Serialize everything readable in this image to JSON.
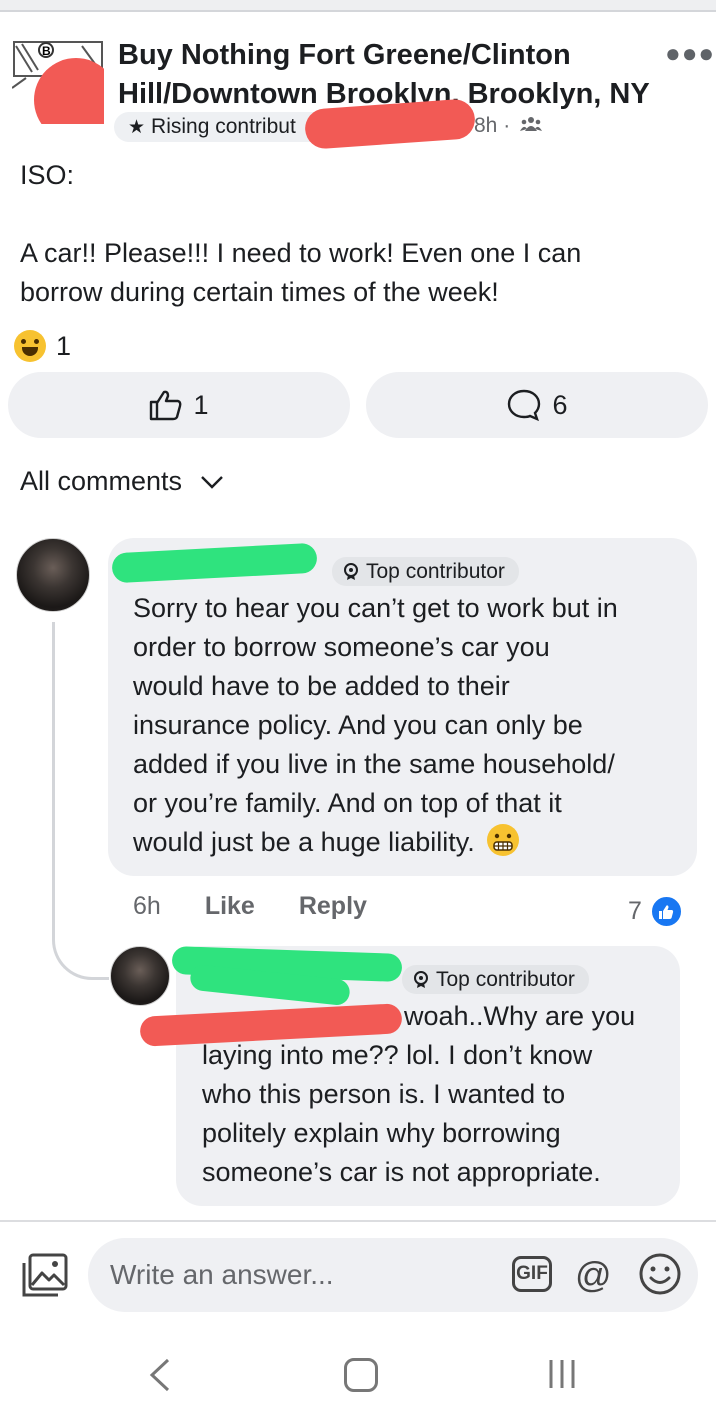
{
  "post": {
    "group_title": "Buy Nothing Fort Greene/Clinton Hill/Downtown Brooklyn, Brooklyn, NY",
    "badge_label": "Rising contribut",
    "time": "8h",
    "separator": "·",
    "audience_icon": "group-icon",
    "text_line1": "ISO:",
    "text_line2": "A car!! Please!!! I need to work! Even one I can",
    "text_line3": "borrow during certain times of the week!",
    "reaction_emoji": "grinning-face",
    "reaction_count": "1",
    "like_count": "1",
    "comment_count": "6"
  },
  "comments_header": {
    "label": "All comments"
  },
  "comment1": {
    "badge": "Top contributor",
    "lines": [
      "Sorry to hear you can’t get to work but in",
      "order to borrow someone’s car you",
      "would have to be added to their",
      "insurance policy. And you can only be",
      "added if you live in the same household/",
      "or you’re family. And on top of that it",
      "would just be a huge liability."
    ],
    "time": "6h",
    "like_label": "Like",
    "reply_label": "Reply",
    "like_count": "7"
  },
  "comment2": {
    "badge": "Top contributor",
    "lines": [
      "woah..Why are you",
      "laying into me?? lol. I don’t know",
      "who this person is. I wanted to",
      "politely explain why borrowing",
      "someone’s car is not appropriate."
    ]
  },
  "composer": {
    "placeholder": "Write an answer...",
    "gif_label": "GIF",
    "at_label": "@"
  },
  "colors": {
    "accent": "#1877f2",
    "bubble": "#eff0f3",
    "redact_red": "#f25a55",
    "redact_green": "#2fe37e"
  }
}
